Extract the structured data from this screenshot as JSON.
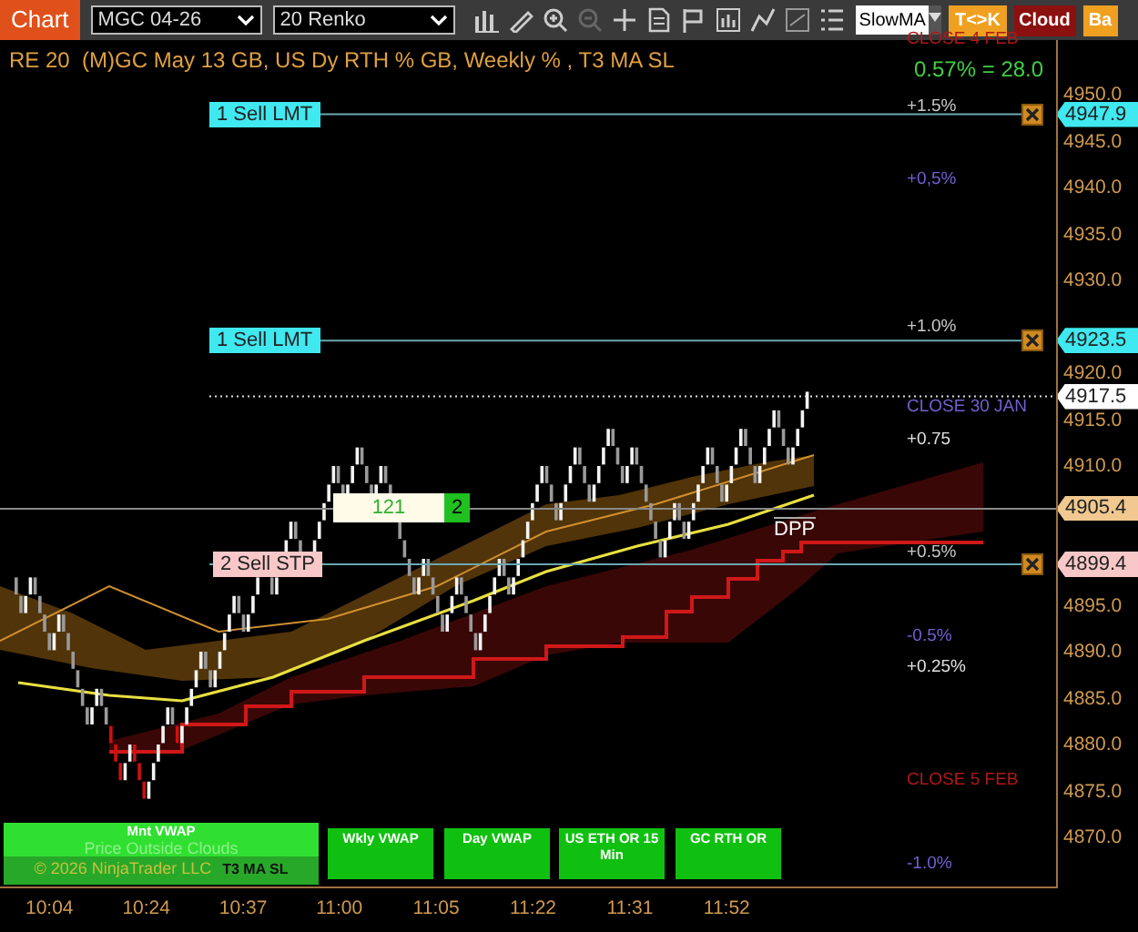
{
  "toolbar": {
    "tab": "Chart",
    "instrument": "MGC 04-26",
    "bar_type": "20 Renko",
    "indicator": "SlowMA",
    "buttons": [
      {
        "label": "T<>K",
        "color": "#f0a020"
      },
      {
        "label": "Cloud",
        "color": "#8b1010"
      },
      {
        "label": "Ba",
        "color": "#f0a020"
      }
    ]
  },
  "chart": {
    "title": "RE 20  (M)GC May 13 GB, US Dy RTH % GB, Weekly % , T3 MA SL",
    "change": "0.57% = 28.0",
    "y_ticks": [
      "4950.0",
      "4945.0",
      "4940.0",
      "4935.0",
      "4930.0",
      "4920.0",
      "4915.0",
      "4910.0",
      "4895.0",
      "4890.0",
      "4885.0",
      "4880.0",
      "4875.0",
      "4870.0"
    ],
    "orders": [
      {
        "label": "1 Sell LMT",
        "color": "#40e8f0"
      },
      {
        "label": "1 Sell LMT",
        "color": "#40e8f0"
      },
      {
        "label": "2 Sell STP",
        "color": "#f8c8c8"
      }
    ],
    "price_markers": [
      {
        "price": "4947.9",
        "kind": "order",
        "color": "#40e8f0"
      },
      {
        "price": "4923.5",
        "kind": "order",
        "color": "#40e8f0"
      },
      {
        "price": "4917.5",
        "kind": "last",
        "color": "#ffffff"
      },
      {
        "price": "4905.4",
        "kind": "level",
        "color": "#f0c890"
      },
      {
        "price": "4899.4",
        "kind": "order",
        "color": "#f8c8c8"
      }
    ],
    "level_labels": [
      {
        "text": "CLOSE 4 FEB",
        "color": "#b01818"
      },
      {
        "text": "+1.5%",
        "color": "#c8c8c8"
      },
      {
        "text": "+0,5%",
        "color": "#7060d0"
      },
      {
        "text": "+1.0%",
        "color": "#c8c8c8"
      },
      {
        "text": "CLOSE 30 JAN",
        "color": "#7060d0"
      },
      {
        "text": "+0.75",
        "color": "#e0e0e0"
      },
      {
        "text": "+0.5%",
        "color": "#c8c8c8"
      },
      {
        "text": "-0.5%",
        "color": "#7060d0"
      },
      {
        "text": "+0.25%",
        "color": "#e0e0e0"
      },
      {
        "text": "CLOSE 5 FEB",
        "color": "#b01818"
      },
      {
        "text": "-1.0%",
        "color": "#7060d0"
      }
    ],
    "position": {
      "quantity": "121",
      "count": "2"
    },
    "pivot_label": "DPP",
    "signal_panel": {
      "title": "Mnt VWAP",
      "note": "Price Outside Clouds",
      "copyright": "© 2026 NinjaTrader LLC",
      "strategy": "T3 MA SL"
    },
    "indicator_buttons": [
      "Wkly VWAP",
      "Day VWAP",
      "US ETH OR 15 Min",
      "GC RTH OR"
    ],
    "x_ticks": [
      "10:04",
      "10:24",
      "10:37",
      "11:00",
      "11:05",
      "11:22",
      "11:31",
      "11:52"
    ]
  }
}
